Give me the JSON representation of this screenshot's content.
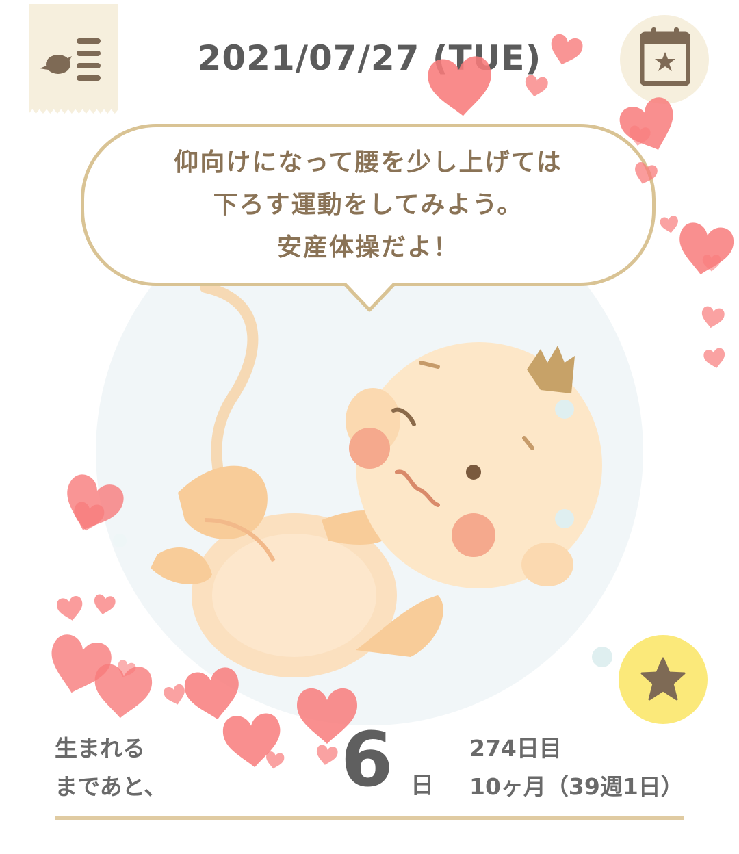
{
  "header": {
    "date": "2021/07/27 (TUE)",
    "menu_icon": "bird-list-menu-icon",
    "calendar_icon": "calendar-star-icon"
  },
  "message": {
    "lines": [
      "仰向けになって腰を少し上げては",
      "下ろす運動をしてみよう。",
      "安産体操だよ！"
    ]
  },
  "illustration": {
    "subject": "baby-in-womb"
  },
  "favorite_icon": "star-icon",
  "countdown": {
    "label_line1": "生まれる",
    "label_line2": "まであと、",
    "days": "6",
    "unit": "日"
  },
  "stats": {
    "day_count": "274日目",
    "months_weeks": "10ヶ月（39週1日）"
  },
  "colors": {
    "accent": "#d9c394",
    "text_brown": "#8a7356",
    "heart": "#f87b7b",
    "star_button": "#fbe97a",
    "icon_brown": "#7e6a55"
  }
}
